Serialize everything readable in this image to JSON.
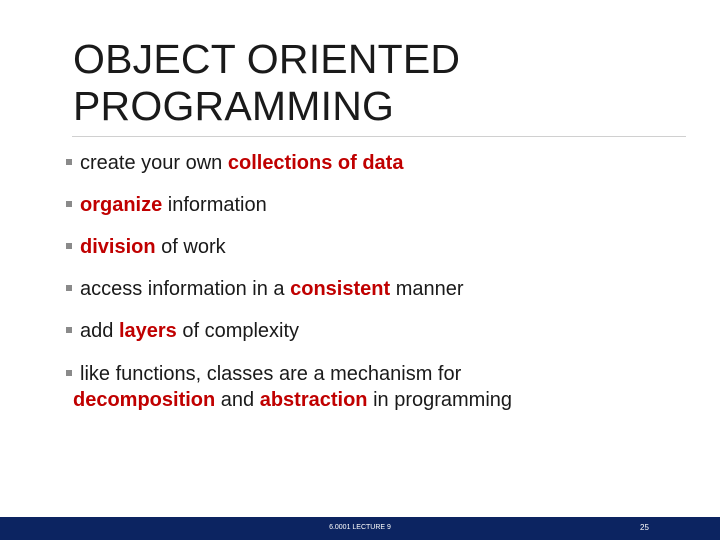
{
  "title": {
    "line1": "OBJECT ORIENTED",
    "line2": "PROGRAMMING"
  },
  "bullets": [
    {
      "pre": "create your own ",
      "hl": "collections of data",
      "post": ""
    },
    {
      "pre": "",
      "hl": "organize",
      "post": " information"
    },
    {
      "pre": "",
      "hl": "division",
      "post": " of work"
    },
    {
      "pre": "access information in a ",
      "hl": "consistent",
      "post": " manner"
    },
    {
      "pre": "add ",
      "hl": "layers",
      "post": " of complexity"
    },
    {
      "pre": "like functions, classes are a mechanism for",
      "hl1": "decomposition",
      "mid": " and ",
      "hl2": "abstraction",
      "post": " in programming"
    }
  ],
  "footer": {
    "label": "6.0001 LECTURE 9",
    "page": "25"
  },
  "colors": {
    "highlight": "#c00000",
    "footer_bg": "#0c2461",
    "bullet_marker": "#8a8a8a"
  },
  "icons": {
    "bullet_marker": "square-bullet-icon"
  }
}
